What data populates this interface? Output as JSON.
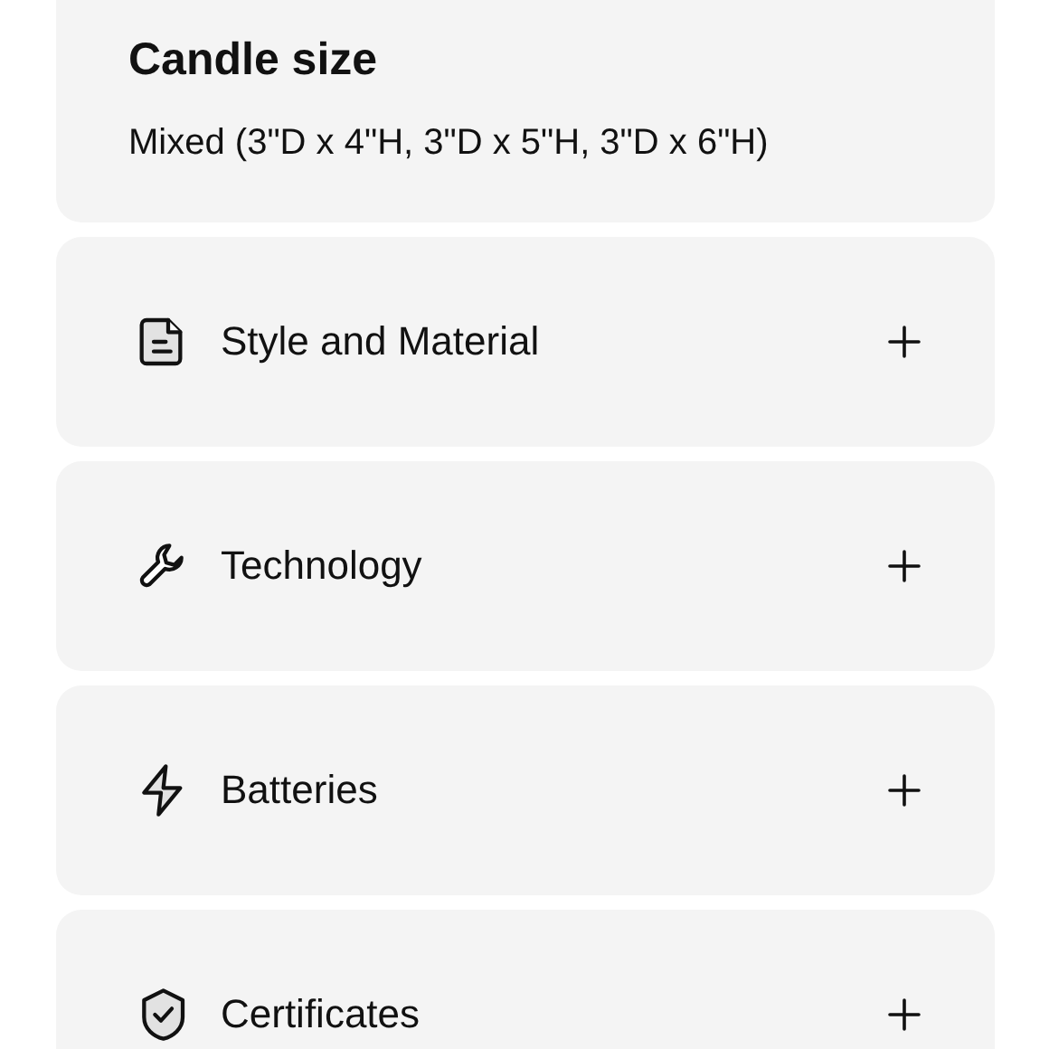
{
  "spec": {
    "title": "Candle size",
    "value": "Mixed (3\"D x 4\"H, 3\"D x 5\"H, 3\"D x 6\"H)"
  },
  "sections": [
    {
      "label": "Style and Material",
      "expanded": false
    },
    {
      "label": "Technology",
      "expanded": false
    },
    {
      "label": "Batteries",
      "expanded": false
    },
    {
      "label": "Certificates",
      "expanded": false
    }
  ]
}
